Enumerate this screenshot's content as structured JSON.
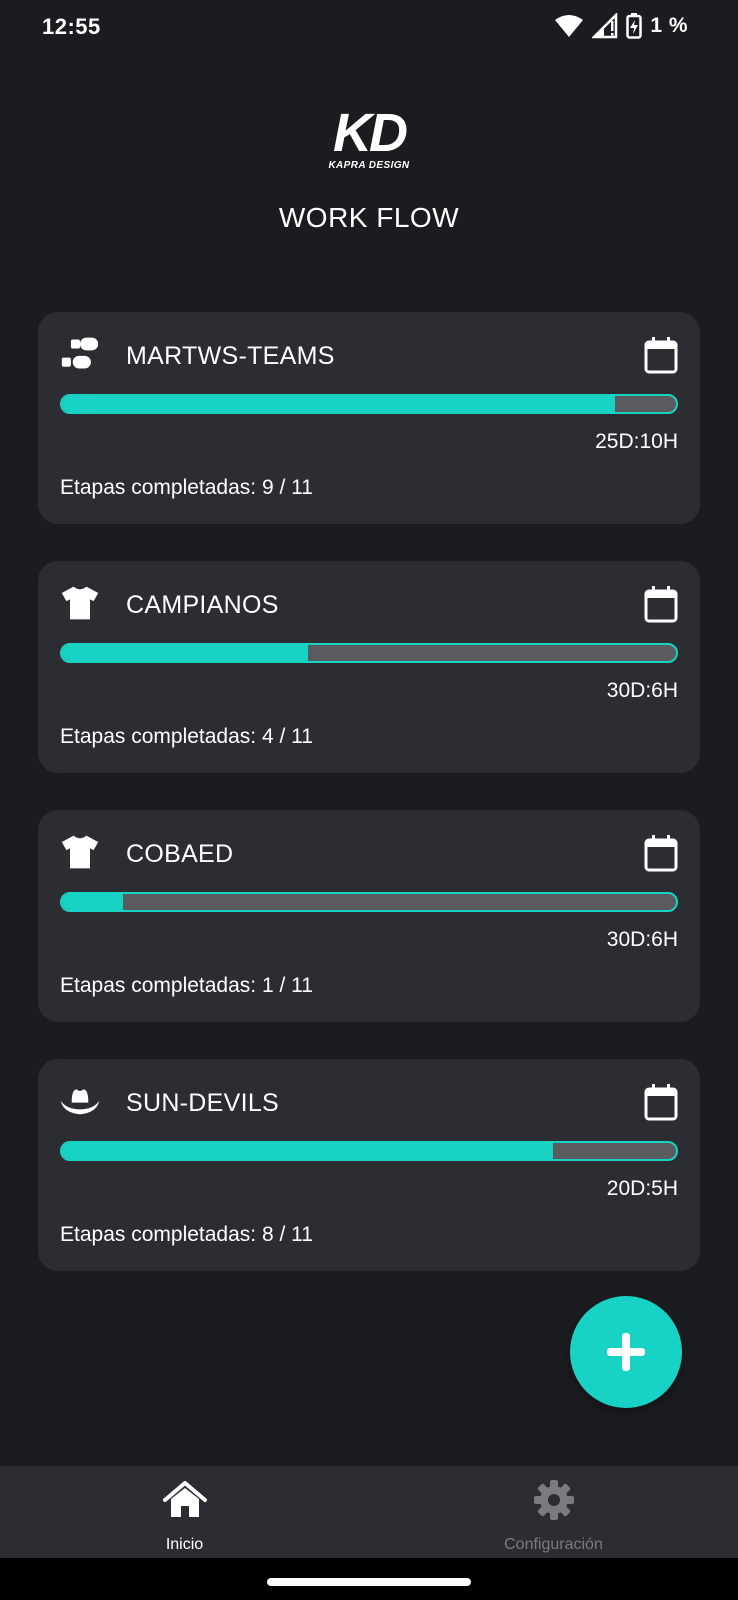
{
  "status_bar": {
    "time": "12:55",
    "battery_percent": "1 %",
    "icons": [
      "wifi-icon",
      "cell-signal-icon",
      "battery-charging-icon"
    ]
  },
  "header": {
    "logo_mark": "KD",
    "logo_sub": "KAPRA DESIGN",
    "title": "WORK FLOW"
  },
  "colors": {
    "background": "#1b1c20",
    "card": "#2c2d32",
    "accent": "#18d3c3",
    "track": "#5a5b5f",
    "inactive": "#7a7b80"
  },
  "cards": [
    {
      "title": "MARTWS-TEAMS",
      "icon": "shoes-icon",
      "time_left": "25D:10H",
      "stages": "Etapas completadas: 9 / 11",
      "progress_percent": 90
    },
    {
      "title": "CAMPIANOS",
      "icon": "tshirt-icon",
      "time_left": "30D:6H",
      "stages": "Etapas completadas: 4 / 11",
      "progress_percent": 40
    },
    {
      "title": "COBAED",
      "icon": "tshirt-icon",
      "time_left": "30D:6H",
      "stages": "Etapas completadas: 1 / 11",
      "progress_percent": 10
    },
    {
      "title": "SUN-DEVILS",
      "icon": "cowboy-hat-icon",
      "time_left": "20D:5H",
      "stages": "Etapas completadas: 8 / 11",
      "progress_percent": 80
    }
  ],
  "fab": {
    "icon": "plus-icon"
  },
  "bottom_nav": {
    "home_label": "Inicio",
    "settings_label": "Configuración"
  }
}
